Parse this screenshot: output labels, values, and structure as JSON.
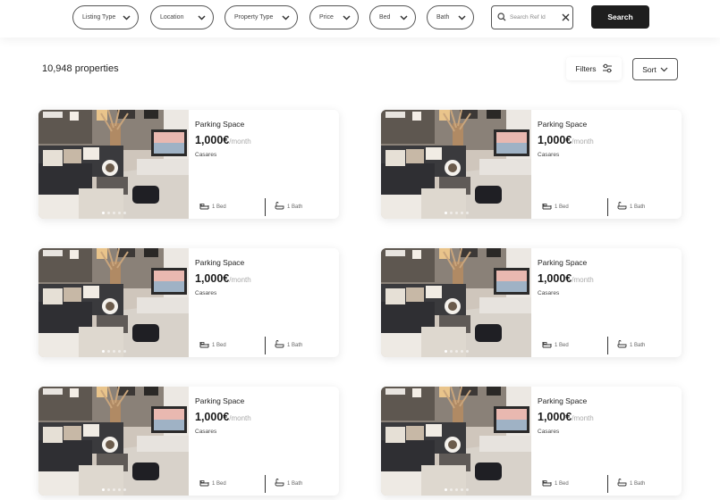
{
  "filters": {
    "listing_type": "Listing Type",
    "location": "Location",
    "property_type": "Property Type",
    "price": "Price",
    "bed": "Bed",
    "bath": "Bath",
    "search_placeholder": "Search Ref Id",
    "search_button": "Search"
  },
  "results": {
    "count_label": "10,948 properties",
    "filters_label": "Filters",
    "sort_label": "Sort"
  },
  "listings": [
    {
      "type": "Parking Space",
      "price": "1,000€",
      "period": "/month",
      "location": "Casares",
      "beds": "1 Bed",
      "baths": "1 Bath",
      "image_index": 1,
      "image_count": 5
    },
    {
      "type": "Parking Space",
      "price": "1,000€",
      "period": "/month",
      "location": "Casares",
      "beds": "1 Bed",
      "baths": "1 Bath",
      "image_index": 1,
      "image_count": 5
    },
    {
      "type": "Parking Space",
      "price": "1,000€",
      "period": "/month",
      "location": "Casares",
      "beds": "1 Bed",
      "baths": "1 Bath",
      "image_index": 1,
      "image_count": 5
    },
    {
      "type": "Parking Space",
      "price": "1,000€",
      "period": "/month",
      "location": "Casares",
      "beds": "1 Bed",
      "baths": "1 Bath",
      "image_index": 1,
      "image_count": 5
    },
    {
      "type": "Parking Space",
      "price": "1,000€",
      "period": "/month",
      "location": "Casares",
      "beds": "1 Bed",
      "baths": "1 Bath",
      "image_index": 1,
      "image_count": 5
    },
    {
      "type": "Parking Space",
      "price": "1,000€",
      "period": "/month",
      "location": "Casares",
      "beds": "1 Bed",
      "baths": "1 Bath",
      "image_index": 1,
      "image_count": 5
    }
  ],
  "icons": {
    "chevron": "chevron-down-icon",
    "search": "search-icon",
    "clear": "close-icon",
    "filters": "sliders-icon",
    "bed": "bed-icon",
    "bath": "bathtub-icon"
  },
  "colors": {
    "primary_button": "#1e1e1e",
    "price_period": "#aaaaaa",
    "border": "#555555"
  }
}
